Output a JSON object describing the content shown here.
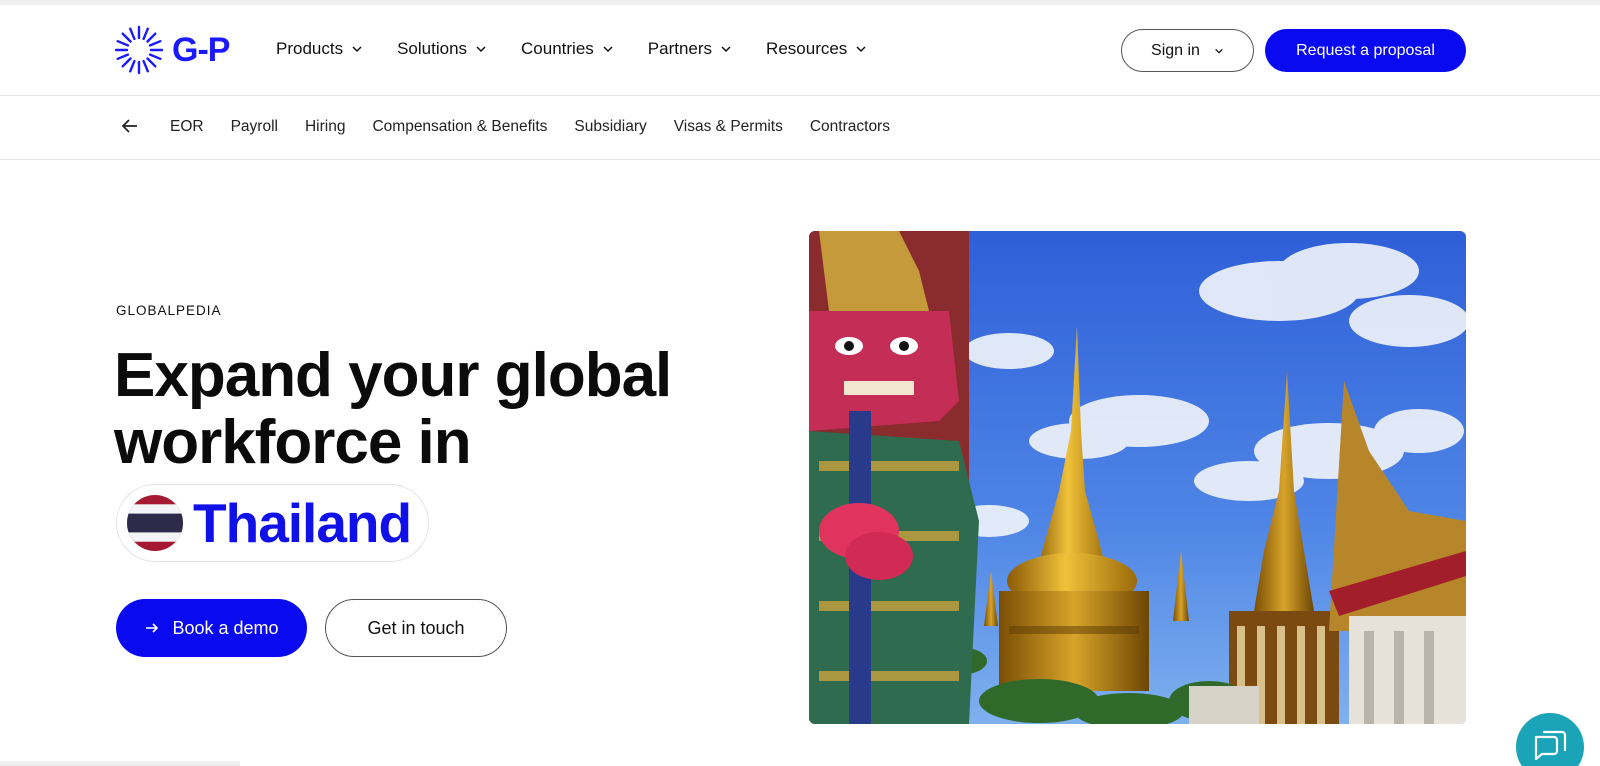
{
  "brand": {
    "name": "G-P",
    "color": "#1a1aff"
  },
  "nav": {
    "items": [
      {
        "label": "Products"
      },
      {
        "label": "Solutions"
      },
      {
        "label": "Countries"
      },
      {
        "label": "Partners"
      },
      {
        "label": "Resources"
      }
    ],
    "signin_label": "Sign in",
    "proposal_label": "Request a proposal"
  },
  "subnav": {
    "items": [
      "EOR",
      "Payroll",
      "Hiring",
      "Compensation & Benefits",
      "Subsidiary",
      "Visas & Permits",
      "Contractors"
    ]
  },
  "hero": {
    "eyebrow": "GLOBALPEDIA",
    "headline_line1": "Expand your global",
    "headline_line2": "workforce in",
    "country": "Thailand",
    "cta_primary": "Book a demo",
    "cta_secondary": "Get in touch",
    "image_alt": "Temple of the Emerald Buddha with giant guardian statue, Bangkok"
  },
  "colors": {
    "accent": "#0a0af0",
    "chat": "#1ba4b7"
  },
  "icons": {
    "back": "arrow-left-icon",
    "dropdown": "chevron-down-icon",
    "chat": "chat-bubbles-icon"
  }
}
